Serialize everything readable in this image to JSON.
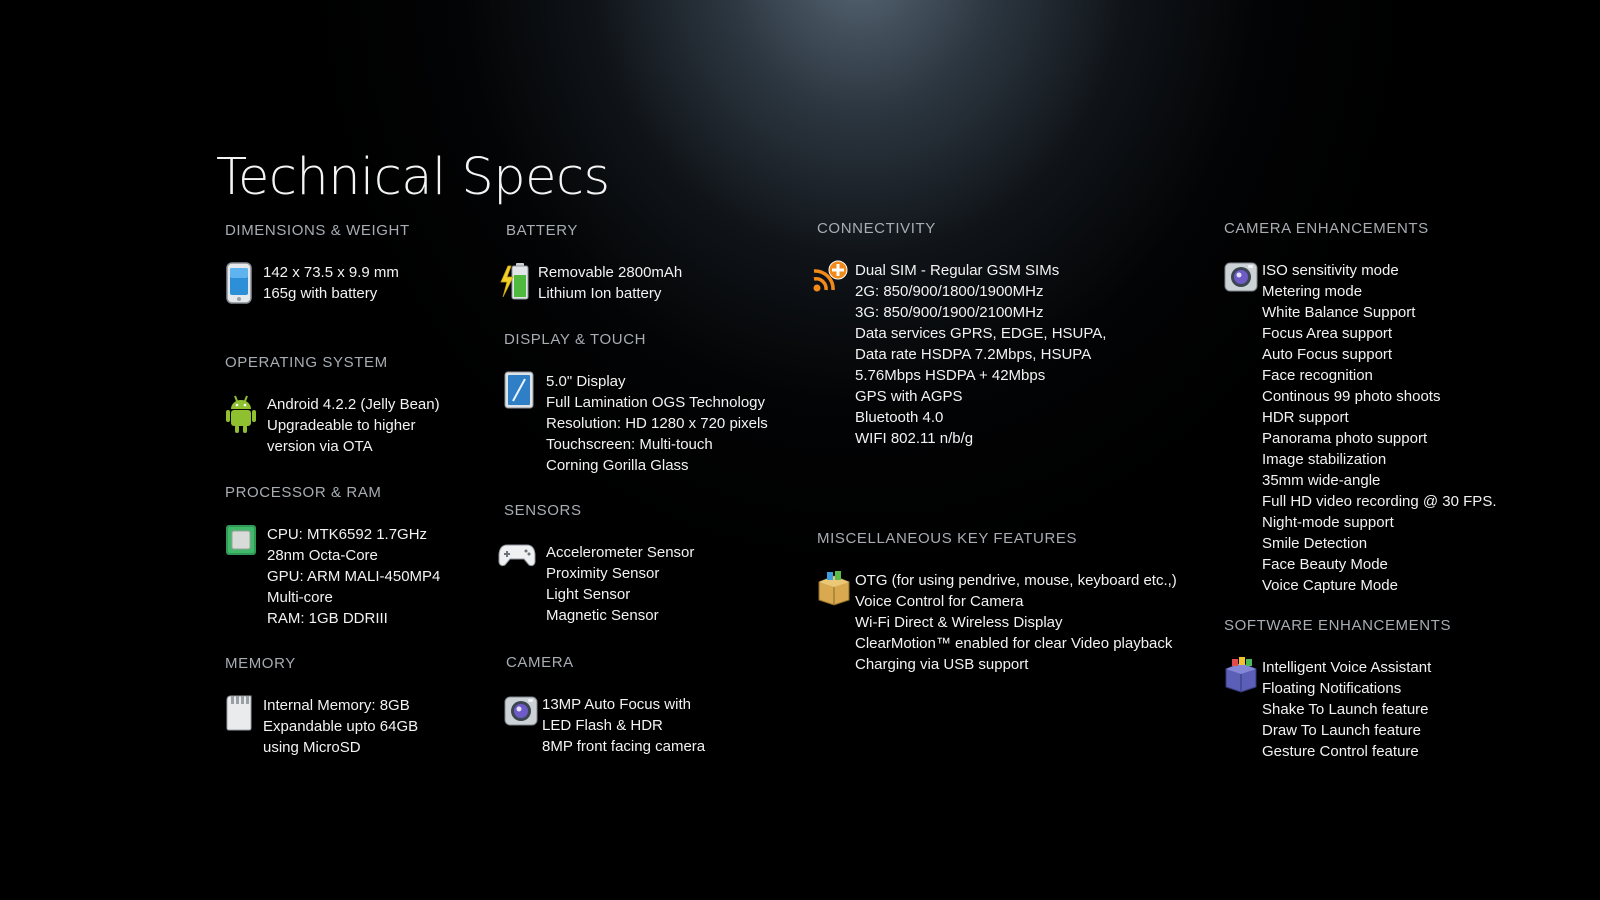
{
  "page": {
    "title": "Technical Specs"
  },
  "colors": {
    "background": "#000000",
    "glow": "#647686",
    "heading": "#a7adb3",
    "text": "#f3f3f3"
  },
  "sections": {
    "dimensions": {
      "heading": "DIMENSIONS & WEIGHT",
      "icon": "phone-icon",
      "lines": [
        "142 x 73.5 x 9.9 mm",
        "165g with battery"
      ]
    },
    "os": {
      "heading": "OPERATING SYSTEM",
      "icon": "android-icon",
      "lines": [
        "Android 4.2.2 (Jelly Bean)",
        "Upgradeable to higher",
        "version via OTA"
      ]
    },
    "processor": {
      "heading": "PROCESSOR & RAM",
      "icon": "chip-icon",
      "lines": [
        "CPU: MTK6592 1.7GHz",
        "28nm Octa-Core",
        "GPU: ARM MALI-450MP4",
        "Multi-core",
        "RAM: 1GB DDRIII"
      ]
    },
    "memory": {
      "heading": "MEMORY",
      "icon": "sd-card-icon",
      "lines": [
        "Internal Memory: 8GB",
        "Expandable upto 64GB",
        "using MicroSD"
      ]
    },
    "battery": {
      "heading": "BATTERY",
      "icon": "battery-icon",
      "lines": [
        "Removable 2800mAh",
        "Lithium Ion battery"
      ]
    },
    "display": {
      "heading": "DISPLAY & TOUCH",
      "icon": "display-icon",
      "lines": [
        "5.0\" Display",
        "Full Lamination OGS Technology",
        "Resolution: HD 1280 x 720 pixels",
        "Touchscreen: Multi-touch",
        "Corning Gorilla Glass"
      ]
    },
    "sensors": {
      "heading": "SENSORS",
      "icon": "gamepad-icon",
      "lines": [
        "Accelerometer Sensor",
        "Proximity Sensor",
        "Light Sensor",
        "Magnetic Sensor"
      ]
    },
    "camera": {
      "heading": "CAMERA",
      "icon": "camera-icon",
      "lines": [
        "13MP Auto Focus with",
        "LED Flash & HDR",
        "8MP front facing camera"
      ]
    },
    "connectivity": {
      "heading": "CONNECTIVITY",
      "icon": "wifi-icon",
      "lines": [
        "Dual SIM - Regular GSM SIMs",
        "2G: 850/900/1800/1900MHz",
        "3G: 850/900/1900/2100MHz",
        "Data services GPRS, EDGE, HSUPA,",
        "Data rate HSDPA 7.2Mbps, HSUPA",
        "5.76Mbps HSDPA + 42Mbps",
        "GPS with AGPS",
        "Bluetooth 4.0",
        "WIFI 802.11 n/b/g"
      ]
    },
    "misc": {
      "heading": "MISCELLANEOUS KEY FEATURES",
      "icon": "box-icon",
      "lines": [
        "OTG (for using pendrive, mouse, keyboard etc.,)",
        "Voice Control for Camera",
        "Wi-Fi Direct & Wireless Display",
        "ClearMotion™ enabled for clear Video playback",
        "Charging via USB support"
      ]
    },
    "camera_enh": {
      "heading": "CAMERA ENHANCEMENTS",
      "icon": "camera-icon",
      "lines": [
        "ISO sensitivity mode",
        "Metering mode",
        "White Balance Support",
        "Focus Area support",
        "Auto Focus support",
        "Face recognition",
        "Continous 99 photo shoots",
        "HDR support",
        "Panorama photo support",
        "Image stabilization",
        "35mm wide-angle",
        "Full HD video recording @ 30 FPS.",
        "Night-mode support",
        "Smile Detection",
        "Face Beauty Mode",
        "Voice Capture Mode"
      ]
    },
    "software_enh": {
      "heading": "SOFTWARE ENHANCEMENTS",
      "icon": "apps-box-icon",
      "lines": [
        "Intelligent Voice Assistant",
        "Floating Notifications",
        "Shake To Launch feature",
        "Draw To Launch feature",
        "Gesture Control feature"
      ]
    }
  }
}
